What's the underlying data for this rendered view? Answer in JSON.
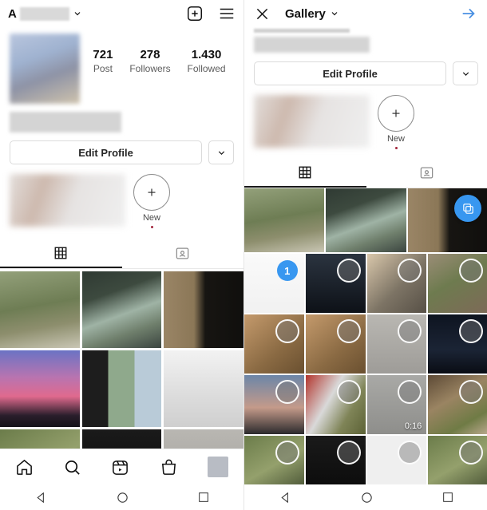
{
  "left_screen": {
    "topbar": {
      "username_prefix": "A",
      "username_redacted": true,
      "dropdown_icon": "chevron-down-icon",
      "add_icon": "plus-square-icon",
      "menu_icon": "hamburger-menu-icon"
    },
    "stats": [
      {
        "num": "721",
        "label": "Post"
      },
      {
        "num": "278",
        "label": "Followers"
      },
      {
        "num": "1.430",
        "label": "Followed"
      }
    ],
    "actions": {
      "edit_profile_label": "Edit Profile",
      "caret_icon": "chevron-down-icon"
    },
    "highlights": {
      "new_label": "New",
      "plus_icon": "plus-icon"
    },
    "tabs": [
      {
        "name": "grid-tab",
        "icon": "grid-icon",
        "active": true
      },
      {
        "name": "tagged-tab",
        "icon": "tagged-person-icon",
        "active": false
      }
    ],
    "grid_cells": [
      {
        "name": "post-grass",
        "fill": "ph-grass"
      },
      {
        "name": "post-tree-road",
        "fill": "ph-tree"
      },
      {
        "name": "post-wall",
        "fill": "ph-wall"
      },
      {
        "name": "post-sunset-train",
        "fill": "ph-sunset"
      },
      {
        "name": "post-triptych",
        "fill": "ph-triple"
      },
      {
        "name": "post-white-sheet",
        "fill": "ph-white"
      },
      {
        "name": "post-row3-a",
        "fill": "ph-leafy"
      },
      {
        "name": "post-row3-b",
        "fill": "ph-blackbar"
      },
      {
        "name": "post-row3-c",
        "fill": "ph-grey"
      }
    ],
    "bottom_nav": [
      {
        "name": "nav-home",
        "icon": "home-icon"
      },
      {
        "name": "nav-search",
        "icon": "search-icon"
      },
      {
        "name": "nav-reels",
        "icon": "reels-icon"
      },
      {
        "name": "nav-shop",
        "icon": "shop-bag-icon"
      },
      {
        "name": "nav-profile",
        "icon": "profile-avatar"
      }
    ]
  },
  "right_screen": {
    "topbar": {
      "close_icon": "close-x-icon",
      "title": "Gallery",
      "dropdown_icon": "chevron-down-icon",
      "next_icon": "arrow-right-icon",
      "next_color": "#4a90e2"
    },
    "actions": {
      "edit_profile_label": "Edit Profile",
      "caret_icon": "chevron-down-icon"
    },
    "highlights": {
      "new_label": "New",
      "plus_icon": "plus-icon"
    },
    "tabs": [
      {
        "name": "grid-tab",
        "icon": "grid-icon",
        "active": true
      },
      {
        "name": "tagged-tab",
        "icon": "tagged-person-icon",
        "active": false
      }
    ],
    "multiselect_fab": {
      "icon": "layers-multiselect-icon",
      "color": "#3897f0"
    },
    "top_preview_row": [
      {
        "name": "preview-grass",
        "fill": "ph-grass"
      },
      {
        "name": "preview-tree-road",
        "fill": "ph-tree"
      },
      {
        "name": "preview-wall",
        "fill": "ph-wall"
      }
    ],
    "gallery_cells": [
      {
        "name": "gallery-screenshot-settings",
        "fill": "ph-screen",
        "selected": true,
        "badge": "1"
      },
      {
        "name": "gallery-screenshot-grid",
        "fill": "ph-dark",
        "selected": false
      },
      {
        "name": "gallery-interior",
        "fill": "ph-tan",
        "selected": false
      },
      {
        "name": "gallery-potted-plants",
        "fill": "ph-plants",
        "selected": false
      },
      {
        "name": "gallery-brown-wall-a",
        "fill": "ph-brown",
        "selected": false
      },
      {
        "name": "gallery-brown-wall-b",
        "fill": "ph-brown",
        "selected": false
      },
      {
        "name": "gallery-grey-panel",
        "fill": "ph-grey",
        "selected": false
      },
      {
        "name": "gallery-night-city",
        "fill": "ph-night",
        "selected": false
      },
      {
        "name": "gallery-dusk-road",
        "fill": "ph-dusk",
        "selected": false
      },
      {
        "name": "gallery-red-roof",
        "fill": "ph-road",
        "selected": false
      },
      {
        "name": "gallery-asphalt-video",
        "fill": "ph-asphalt",
        "selected": false,
        "duration": "0:16"
      },
      {
        "name": "gallery-patio-plants",
        "fill": "ph-patio",
        "selected": false
      },
      {
        "name": "gallery-leafy",
        "fill": "ph-leafy",
        "selected": false
      },
      {
        "name": "gallery-dark-strip",
        "fill": "ph-blackbar",
        "selected": false
      },
      {
        "name": "gallery-document",
        "fill": "ph-doc",
        "selected": false
      },
      {
        "name": "gallery-garden",
        "fill": "ph-leafy",
        "selected": false
      }
    ]
  },
  "android_nav": [
    {
      "name": "android-back-button",
      "icon": "triangle-back-icon"
    },
    {
      "name": "android-home-button",
      "icon": "circle-home-icon"
    },
    {
      "name": "android-recents-button",
      "icon": "square-recents-icon"
    }
  ]
}
